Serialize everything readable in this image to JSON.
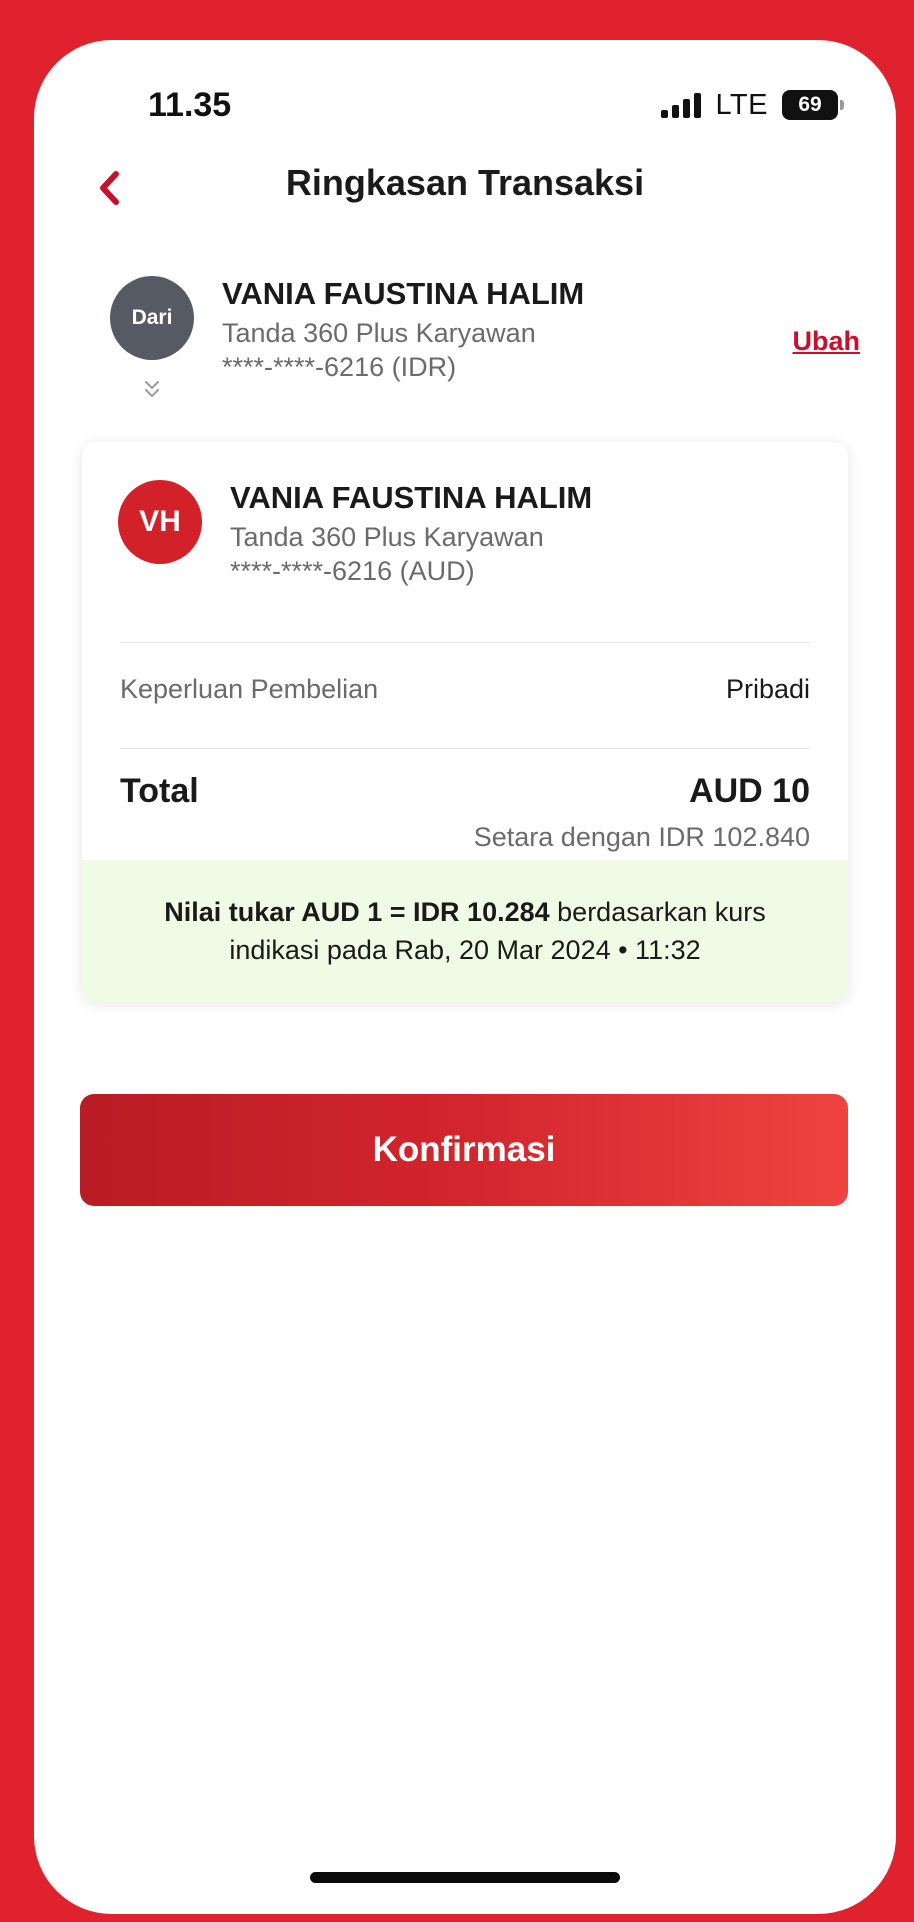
{
  "status_bar": {
    "time": "11.35",
    "network": "LTE",
    "battery": "69"
  },
  "header": {
    "title": "Ringkasan Transaksi"
  },
  "source": {
    "badge": "Dari",
    "name": "VANIA FAUSTINA HALIM",
    "product": "Tanda 360 Plus Karyawan",
    "account": "****-****-6216 (IDR)",
    "change_label": "Ubah"
  },
  "destination": {
    "initials": "VH",
    "name": "VANIA FAUSTINA HALIM",
    "product": "Tanda 360 Plus Karyawan",
    "account": "****-****-6216 (AUD)"
  },
  "details": {
    "purpose_label": "Keperluan Pembelian",
    "purpose_value": "Pribadi",
    "total_label": "Total",
    "total_value": "AUD 10",
    "equivalent": "Setara dengan IDR 102.840"
  },
  "rate": {
    "bold": "Nilai tukar AUD 1 = IDR 10.284",
    "rest": " berdasarkan kurs",
    "line2": "indikasi pada Rab, 20 Mar 2024 • 11:32"
  },
  "confirm_label": "Konfirmasi",
  "colors": {
    "brand": "#d3212a",
    "frame": "#e0222e",
    "rate_bg": "#f0fbe6"
  }
}
